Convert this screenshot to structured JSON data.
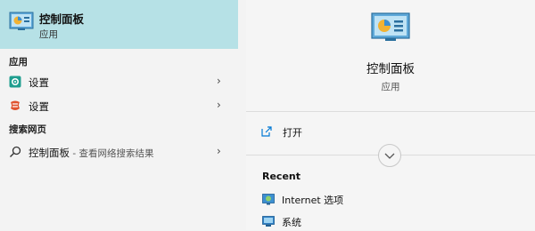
{
  "best_match": {
    "title": "控制面板",
    "subtitle": "应用",
    "icon": "control-panel-icon"
  },
  "sections": {
    "apps_header": "应用",
    "web_header": "搜索网页"
  },
  "app_results": [
    {
      "label": "设置",
      "icon": "settings-icon"
    },
    {
      "label": "设置",
      "icon": "settings-alt-icon"
    }
  ],
  "web_result": {
    "label": "控制面板",
    "suffix": " - 查看网络搜索结果",
    "icon": "search-icon"
  },
  "detail": {
    "title": "控制面板",
    "subtitle": "应用",
    "open_label": "打开",
    "recent_header": "Recent",
    "recent": [
      {
        "label": "Internet 选项",
        "icon": "internet-options-icon"
      },
      {
        "label": "系统",
        "icon": "system-icon"
      }
    ]
  },
  "colors": {
    "highlight": "#b6e1e6",
    "accent": "#0078d4"
  }
}
